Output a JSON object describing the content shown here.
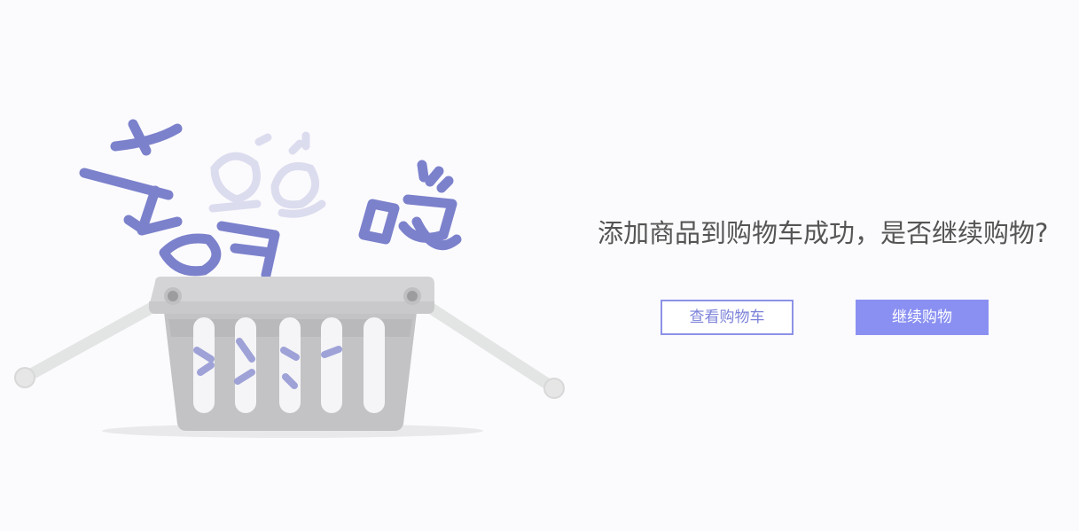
{
  "illustration": {
    "icon": "shopping-basket-icon",
    "basket_color": "#c2c2c4",
    "handle_color": "#e6e7e7",
    "letters_color": "#7c81cc",
    "faded_letters_color": "#d6d7ee"
  },
  "message": {
    "text": "添加商品到购物车成功，是否继续购物?",
    "color": "#555555"
  },
  "buttons": {
    "view_cart_label": "查看购物车",
    "continue_label": "继续购物",
    "accent_color": "#8a90f2"
  }
}
